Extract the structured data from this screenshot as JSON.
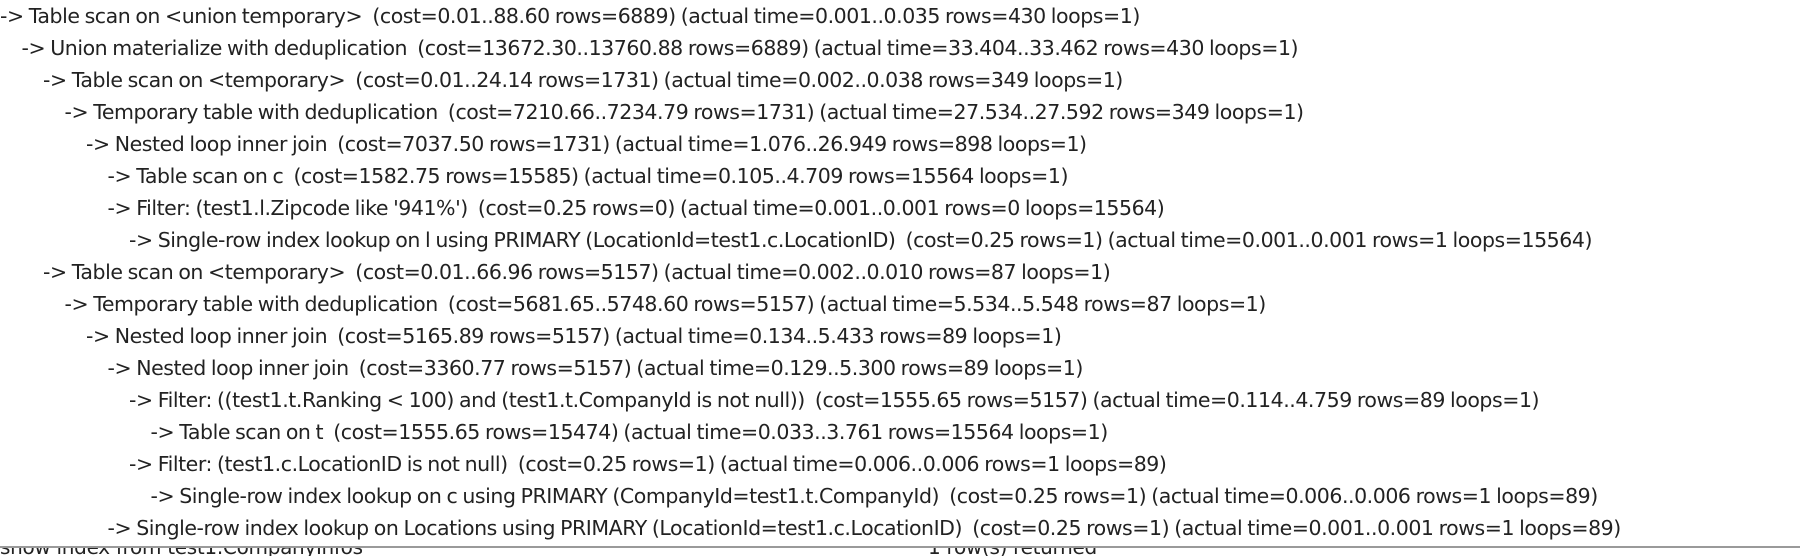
{
  "plan": {
    "lines": [
      {
        "indent": 0,
        "text": "-> Table scan on <union temporary>  (cost=0.01..88.60 rows=6889) (actual time=0.001..0.035 rows=430 loops=1)"
      },
      {
        "indent": 1,
        "text": "-> Union materialize with deduplication  (cost=13672.30..13760.88 rows=6889) (actual time=33.404..33.462 rows=430 loops=1)"
      },
      {
        "indent": 2,
        "text": "-> Table scan on <temporary>  (cost=0.01..24.14 rows=1731) (actual time=0.002..0.038 rows=349 loops=1)"
      },
      {
        "indent": 3,
        "text": "-> Temporary table with deduplication  (cost=7210.66..7234.79 rows=1731) (actual time=27.534..27.592 rows=349 loops=1)"
      },
      {
        "indent": 4,
        "text": "-> Nested loop inner join  (cost=7037.50 rows=1731) (actual time=1.076..26.949 rows=898 loops=1)"
      },
      {
        "indent": 5,
        "text": "-> Table scan on c  (cost=1582.75 rows=15585) (actual time=0.105..4.709 rows=15564 loops=1)"
      },
      {
        "indent": 5,
        "text": "-> Filter: (test1.l.Zipcode like '941%')  (cost=0.25 rows=0) (actual time=0.001..0.001 rows=0 loops=15564)"
      },
      {
        "indent": 6,
        "text": "-> Single-row index lookup on l using PRIMARY (LocationId=test1.c.LocationID)  (cost=0.25 rows=1) (actual time=0.001..0.001 rows=1 loops=15564)"
      },
      {
        "indent": 2,
        "text": "-> Table scan on <temporary>  (cost=0.01..66.96 rows=5157) (actual time=0.002..0.010 rows=87 loops=1)"
      },
      {
        "indent": 3,
        "text": "-> Temporary table with deduplication  (cost=5681.65..5748.60 rows=5157) (actual time=5.534..5.548 rows=87 loops=1)"
      },
      {
        "indent": 4,
        "text": "-> Nested loop inner join  (cost=5165.89 rows=5157) (actual time=0.134..5.433 rows=89 loops=1)"
      },
      {
        "indent": 5,
        "text": "-> Nested loop inner join  (cost=3360.77 rows=5157) (actual time=0.129..5.300 rows=89 loops=1)"
      },
      {
        "indent": 6,
        "text": "-> Filter: ((test1.t.Ranking < 100) and (test1.t.CompanyId is not null))  (cost=1555.65 rows=5157) (actual time=0.114..4.759 rows=89 loops=1)"
      },
      {
        "indent": 7,
        "text": "-> Table scan on t  (cost=1555.65 rows=15474) (actual time=0.033..3.761 rows=15564 loops=1)"
      },
      {
        "indent": 6,
        "text": "-> Filter: (test1.c.LocationID is not null)  (cost=0.25 rows=1) (actual time=0.006..0.006 rows=1 loops=89)"
      },
      {
        "indent": 7,
        "text": "-> Single-row index lookup on c using PRIMARY (CompanyId=test1.t.CompanyId)  (cost=0.25 rows=1) (actual time=0.006..0.006 rows=1 loops=89)"
      },
      {
        "indent": 5,
        "text": "-> Single-row index lookup on Locations using PRIMARY (LocationId=test1.c.LocationID)  (cost=0.25 rows=1) (actual time=0.001..0.001 rows=1 loops=89)"
      }
    ]
  },
  "status": {
    "query": "show index from test1.CompanyInfos",
    "result": "1 row(s) returned"
  }
}
